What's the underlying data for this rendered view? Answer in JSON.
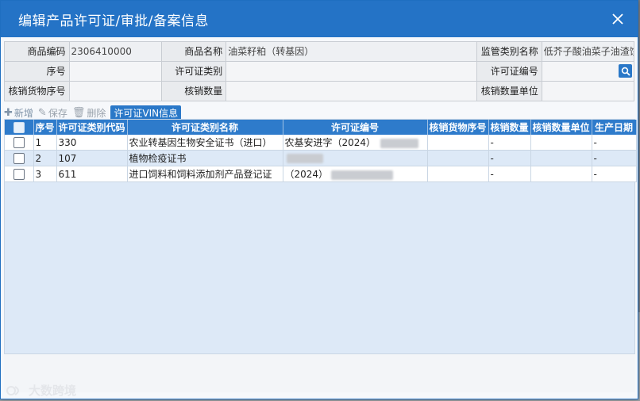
{
  "dialog": {
    "title": "编辑产品许可证/审批/备案信息"
  },
  "form": {
    "row1": {
      "code_label": "商品编码",
      "code_value": "2306410000",
      "name_label": "商品名称",
      "name_value": "油菜籽粕（转基因）",
      "category_label": "监管类别名称",
      "category_value": "低芥子酸油菜子油渣饼"
    },
    "row2": {
      "seq_label": "序号",
      "seq_value": "",
      "type_label": "许可证类别",
      "type_value": "",
      "number_label": "许可证编号",
      "number_value": ""
    },
    "row3": {
      "goods_seq_label": "核销货物序号",
      "goods_seq_value": "",
      "qty_label": "核销数量",
      "qty_value": "",
      "unit_label": "核销数量单位",
      "unit_value": ""
    }
  },
  "toolbar": {
    "add": "新增",
    "save": "保存",
    "delete": "删除",
    "vin": "许可证VIN信息"
  },
  "grid": {
    "columns": [
      "序号",
      "许可证类别代码",
      "许可证类别名称",
      "许可证编号",
      "核销货物序号",
      "核销数量",
      "核销数量单位",
      "生产日期"
    ],
    "rows": [
      {
        "seq": "1",
        "code": "330",
        "name": "农业转基因生物安全证书（进口）",
        "number": "农基安进字（2024）",
        "goods_seq": "",
        "qty": "-",
        "unit": "",
        "date": "-"
      },
      {
        "seq": "2",
        "code": "107",
        "name": "植物检疫证书",
        "number": "",
        "goods_seq": "",
        "qty": "-",
        "unit": "",
        "date": "-"
      },
      {
        "seq": "3",
        "code": "611",
        "name": "进口饲料和饲料添加剂产品登记证",
        "number": "（2024）",
        "goods_seq": "",
        "qty": "-",
        "unit": "",
        "date": "-"
      }
    ]
  },
  "watermark": {
    "text": "大数跨境"
  }
}
